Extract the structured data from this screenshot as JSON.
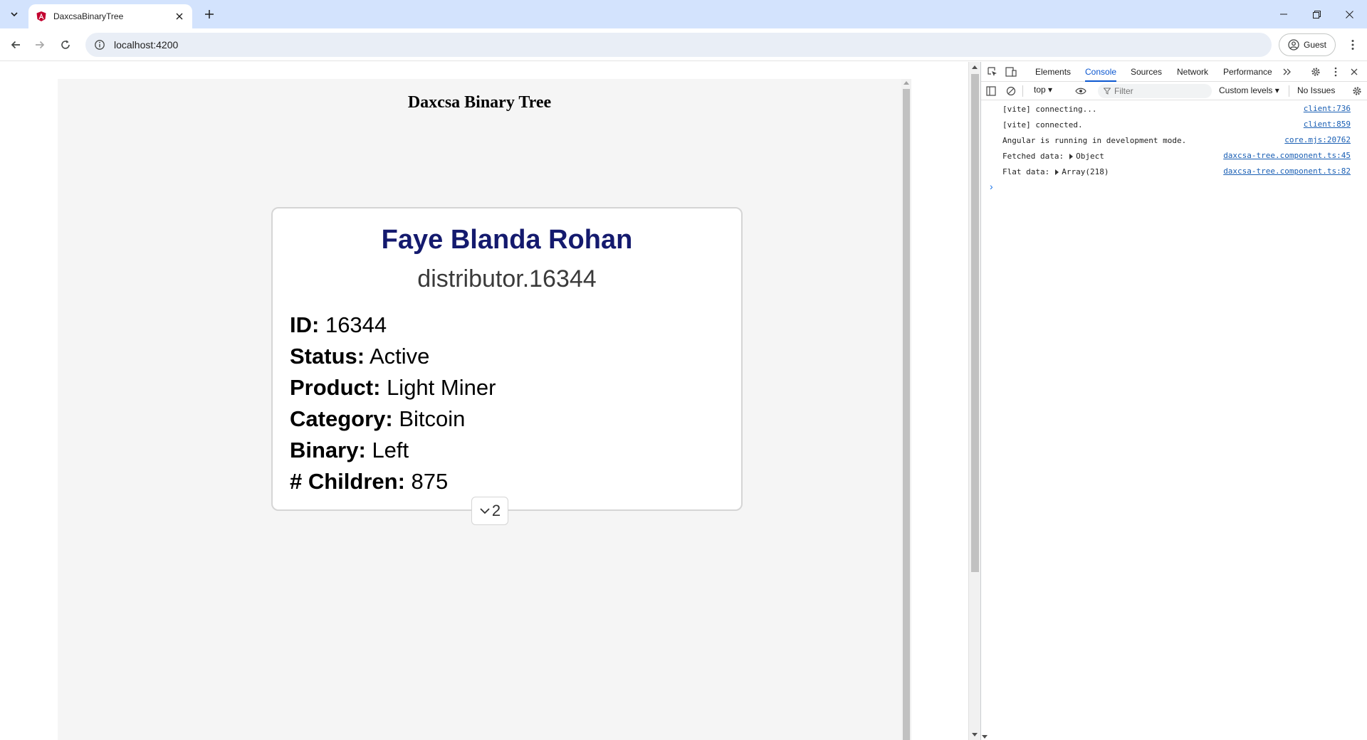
{
  "browser": {
    "tab_title": "DaxcsaBinaryTree",
    "url": "localhost:4200",
    "profile_label": "Guest"
  },
  "app": {
    "title": "Daxcsa Binary Tree",
    "node": {
      "name": "Faye Blanda Rohan",
      "username": "distributor.16344",
      "fields": [
        {
          "label": "ID:",
          "value": "16344"
        },
        {
          "label": "Status:",
          "value": "Active"
        },
        {
          "label": "Product:",
          "value": "Light Miner"
        },
        {
          "label": "Category:",
          "value": "Bitcoin"
        },
        {
          "label": "Binary:",
          "value": "Left"
        },
        {
          "label": "# Children:",
          "value": "875"
        }
      ],
      "expand_count": "2"
    }
  },
  "devtools": {
    "tabs": [
      "Elements",
      "Console",
      "Sources",
      "Network",
      "Performance"
    ],
    "active_tab": "Console",
    "context": "top",
    "filter_placeholder": "Filter",
    "levels": "Custom levels",
    "issues": "No Issues",
    "logs": [
      {
        "message": "[vite] connecting...",
        "expandable": "",
        "source": "client:736"
      },
      {
        "message": "[vite] connected.",
        "expandable": "",
        "source": "client:859"
      },
      {
        "message": "Angular is running in development mode.",
        "expandable": "",
        "source": "core.mjs:20762"
      },
      {
        "message": "Fetched data:",
        "expandable": "Object",
        "source": "daxcsa-tree.component.ts:45"
      },
      {
        "message": "Flat data:",
        "expandable": "Array(218)",
        "source": "daxcsa-tree.component.ts:82"
      }
    ]
  }
}
